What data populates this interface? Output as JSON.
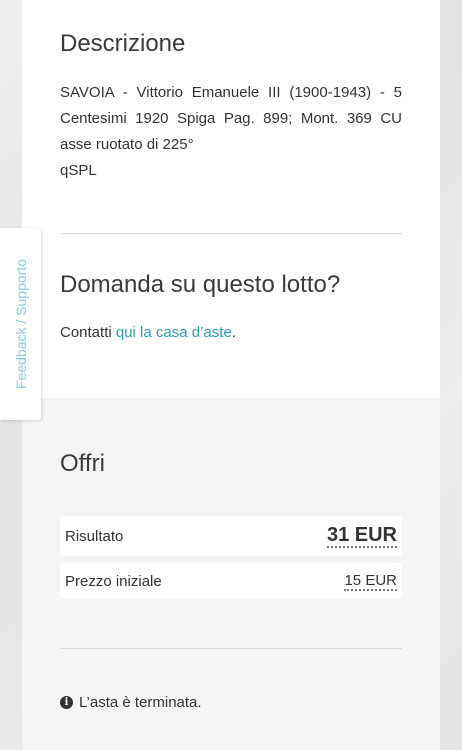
{
  "description": {
    "title": "Descrizione",
    "line1": "SAVOIA - Vittorio Emanuele III (1900-1943) - 5 Centesimi 1920 Spiga Pag. 899; Mont. 369 CU asse ruotato di 225°",
    "line2": "qSPL"
  },
  "question": {
    "title": "Domanda su questo lotto?",
    "contact_prefix": "Contatti ",
    "contact_link": "qui la casa d’aste",
    "contact_suffix": "."
  },
  "offer": {
    "title": "Offri",
    "result_label": "Risultato",
    "result_value": "31 EUR",
    "start_label": "Prezzo iniziale",
    "start_value": "15 EUR",
    "status": "L’asta è terminata.",
    "status_icon": "info-icon"
  },
  "feedback_tab": {
    "label": "Feedback / Supporto"
  }
}
